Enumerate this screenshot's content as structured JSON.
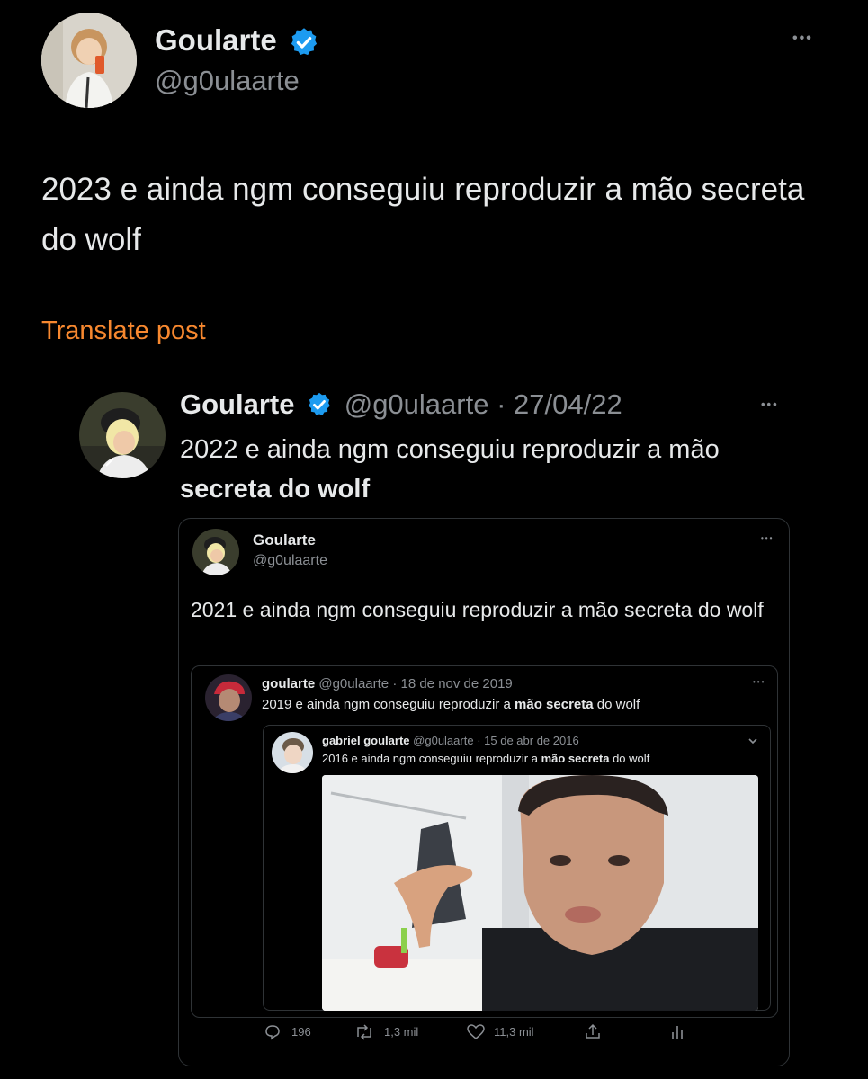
{
  "main_post": {
    "display_name": "Goularte",
    "handle": "@g0ulaarte",
    "text": "2023 e ainda ngm conseguiu reproduzir a mão secreta do wolf",
    "translate": "Translate post",
    "more": "•••"
  },
  "quote1": {
    "display_name": "Goularte",
    "handle": "@g0ulaarte",
    "sep": "·",
    "date": "27/04/22",
    "text_start": "2022 e ainda ngm conseguiu reproduzir a mão ",
    "text_bold": "secreta do wolf",
    "more": "•••"
  },
  "quote2": {
    "display_name": "Goularte",
    "handle": "@g0ulaarte",
    "text": "2021 e ainda ngm conseguiu reproduzir a mão secreta do wolf",
    "more": "•••"
  },
  "quote3": {
    "display_name": "goularte",
    "handle": "@g0ulaarte",
    "sep": "·",
    "date": "18 de nov de 2019",
    "text_start": "2019 e ainda ngm conseguiu reproduzir a ",
    "text_bold": "mão secreta",
    "text_end": " do wolf",
    "more": "•••"
  },
  "quote4": {
    "display_name": "gabriel goularte",
    "handle": "@g0ulaarte",
    "sep": "·",
    "date": "15 de abr de 2016",
    "text_start": "2016 e ainda ngm conseguiu reproduzir a ",
    "text_bold": "mão secreta",
    "text_end": " do wolf"
  },
  "actions": {
    "replies": "196",
    "retweets": "1,3 mil",
    "likes": "11,3 mil"
  },
  "colors": {
    "accent_orange": "#f7882f",
    "verified_blue": "#1d9bf0",
    "text": "#e7e9ea",
    "muted": "#8b8f94",
    "border": "#2f3336"
  },
  "icons": [
    "verified-badge-icon",
    "more-options-icon",
    "reply-icon",
    "retweet-icon",
    "like-icon",
    "share-icon",
    "analytics-icon",
    "chevron-down-icon"
  ]
}
